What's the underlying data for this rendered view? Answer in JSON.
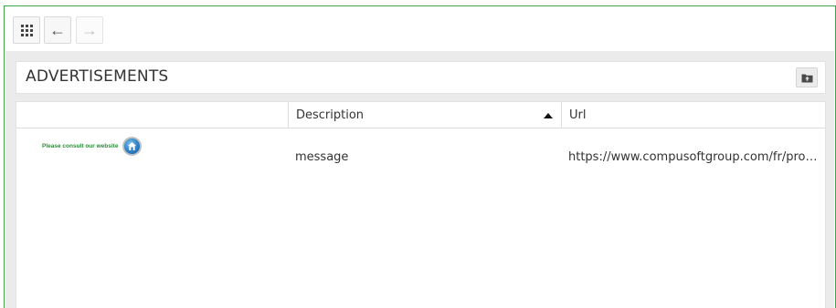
{
  "toolbar": {
    "grid_icon": "grid-icon",
    "back_icon": "arrow-left-icon",
    "forward_icon": "arrow-right-icon",
    "back_glyph": "←",
    "forward_glyph": "→"
  },
  "panel": {
    "title": "ADVERTISEMENTS",
    "export_icon": "folder-export-icon"
  },
  "table": {
    "columns": [
      "",
      "Description",
      "Url"
    ],
    "sorted_column": "Description",
    "sort_direction": "ascending",
    "rows": [
      {
        "ad_text": "Please consult our website",
        "ad_icon": "home-icon",
        "description": "message",
        "url": "https://www.compusoftgroup.com/fr/produits/showroom"
      }
    ]
  },
  "colors": {
    "frame_border": "#3ea64a",
    "ad_text": "#2e8b3a",
    "background": "#ebebeb"
  }
}
